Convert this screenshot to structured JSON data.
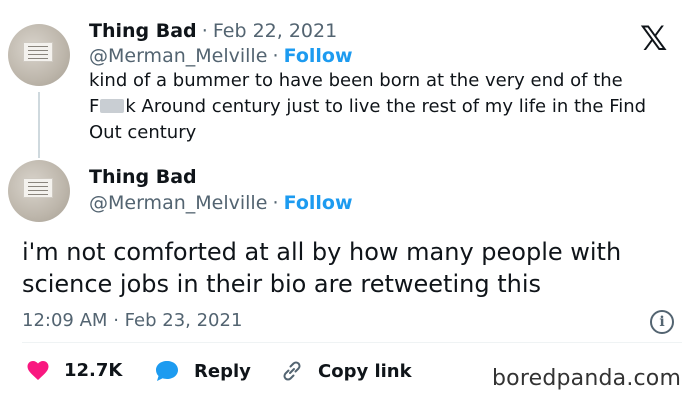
{
  "quoted_tweet": {
    "name": "Thing Bad",
    "date": "Feb 22, 2021",
    "handle": "@Merman_Melville",
    "follow_label": "Follow",
    "text_line1": "kind of a bummer to have been born at the very end of the",
    "text_line2_pre": "F",
    "text_line2_post": "k Around century just to live the rest of my life in the Find",
    "text_line3": "Out century"
  },
  "main_tweet": {
    "name": "Thing Bad",
    "handle": "@Merman_Melville",
    "follow_label": "Follow",
    "text": "i'm not comforted at all by how many people with science jobs in their bio are retweeting this",
    "time": "12:09 AM",
    "date": "Feb 23, 2021"
  },
  "separator": "·",
  "actions": {
    "like_count": "12.7K",
    "reply_label": "Reply",
    "copy_link_label": "Copy link"
  },
  "watermark": "boredpanda.com",
  "colors": {
    "accent": "#1d9bf0",
    "like": "#f91880",
    "text": "#0f1419",
    "muted": "#536471"
  }
}
